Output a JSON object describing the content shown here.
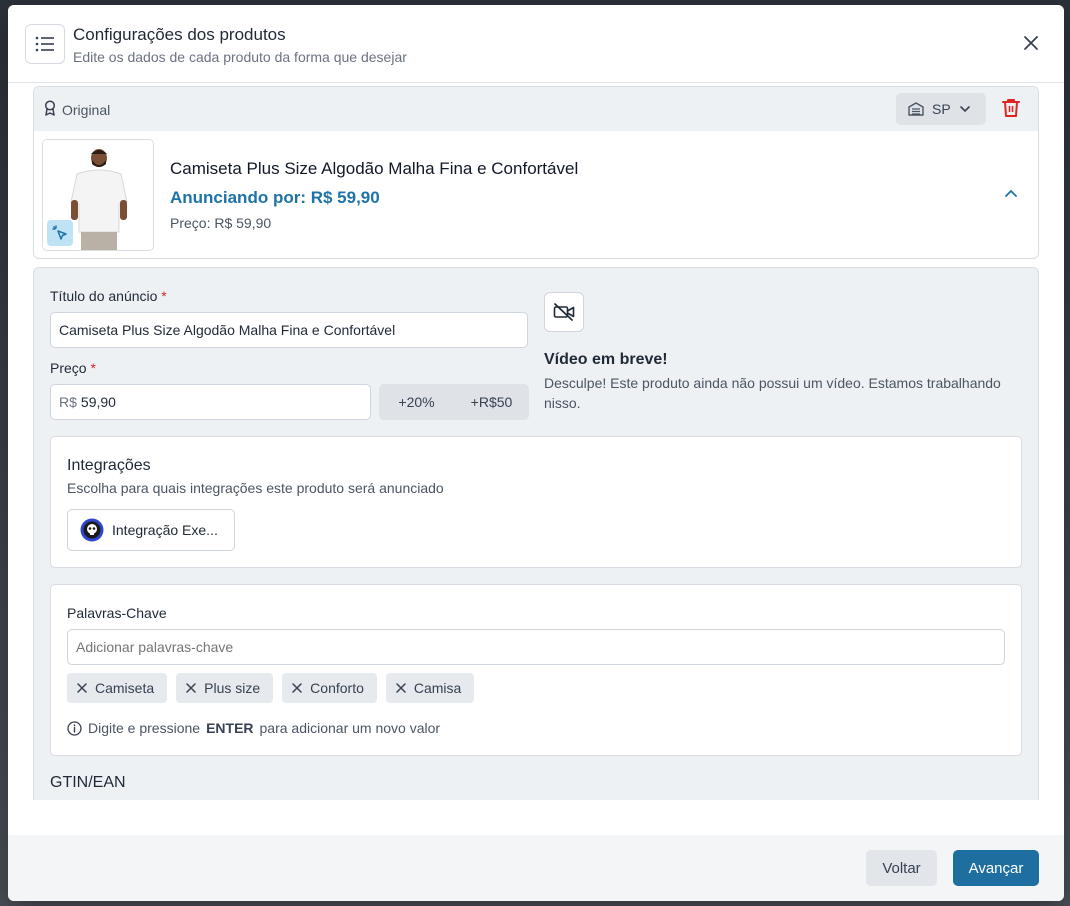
{
  "header": {
    "title": "Configurações dos produtos",
    "subtitle": "Edite os dados de cada produto da forma que desejar"
  },
  "original": {
    "label": "Original",
    "region": "SP"
  },
  "product": {
    "name": "Camiseta Plus Size Algodão Malha Fina e Confortável",
    "advertising": "Anunciando por: R$ 59,90",
    "price": "Preço: R$ 59,90"
  },
  "form": {
    "title_label": "Título do anúncio",
    "title_value": "Camiseta Plus Size Algodão Malha Fina e Confortável",
    "price_label": "Preço",
    "required_mark": "*",
    "price_prefix": "R$",
    "price_value": "59,90",
    "quick_percent": "+20%",
    "quick_amount": "+R$50"
  },
  "video": {
    "title": "Vídeo em breve!",
    "description": "Desculpe! Este produto ainda não possui um vídeo. Estamos trabalhando nisso."
  },
  "integrations": {
    "title": "Integrações",
    "subtitle": "Escolha para quais integrações este produto será anunciado",
    "button_label": "Integração Exe..."
  },
  "keywords": {
    "title": "Palavras-Chave",
    "placeholder": "Adicionar palavras-chave",
    "chips": [
      "Camiseta",
      "Plus size",
      "Conforto",
      "Camisa"
    ],
    "hint_prefix": "Digite e pressione",
    "hint_key": "ENTER",
    "hint_suffix": "para adicionar um novo valor"
  },
  "gtin": {
    "label": "GTIN/EAN"
  },
  "footer": {
    "back": "Voltar",
    "next": "Avançar"
  },
  "colors": {
    "accent": "#1f6ea0",
    "advertising_text": "#1e73a8",
    "delete": "#dc2626"
  }
}
